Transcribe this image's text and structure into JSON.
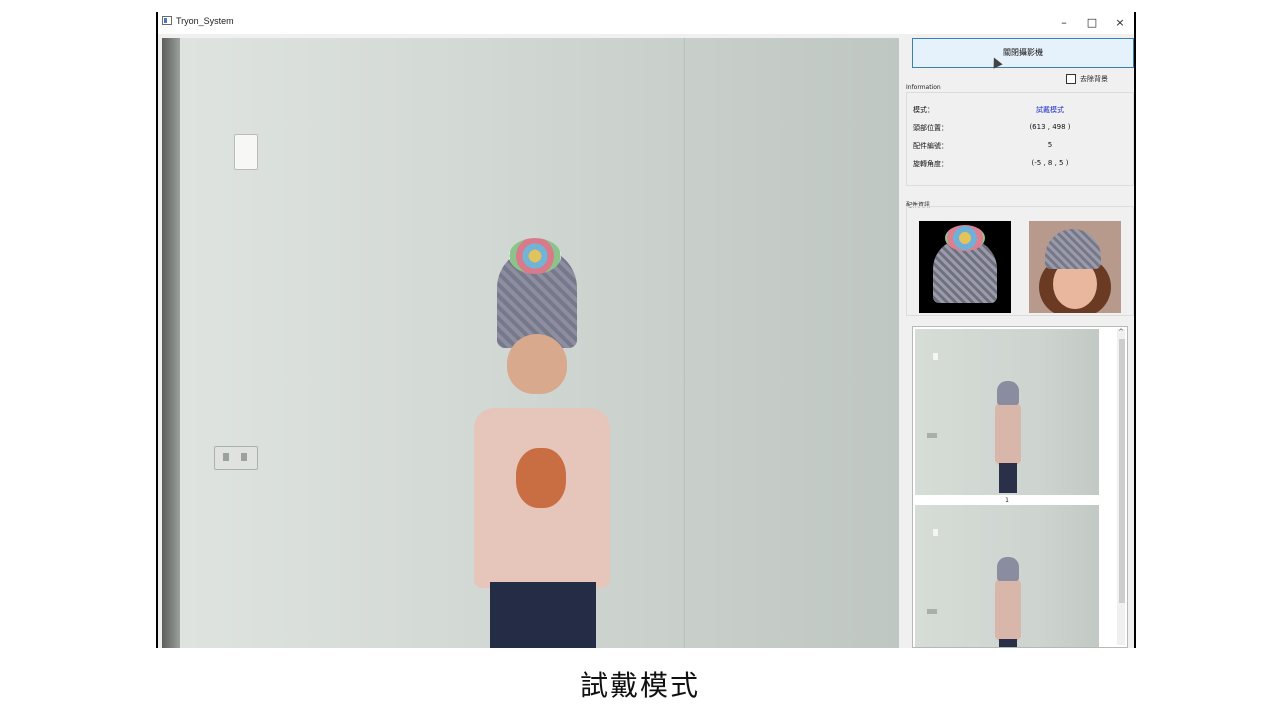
{
  "window": {
    "title": "Tryon_System",
    "minimize_glyph": "–",
    "maximize_glyph": "□",
    "close_glyph": "×"
  },
  "sidebar": {
    "close_camera_label": "關閉攝影機",
    "remove_bg_label": "去除背景",
    "remove_bg_checked": false,
    "info_group_label": "Information",
    "info": [
      {
        "label": "模式：",
        "value": "試戴模式"
      },
      {
        "label": "頭部位置：",
        "value": "(613 , 498 )"
      },
      {
        "label": "配件編號：",
        "value": "5"
      },
      {
        "label": "旋轉角度：",
        "value": "(-5 , 8 , 5 )"
      }
    ],
    "accessory_group_label": "配件資訊",
    "snapshots": [
      {
        "label": "1"
      },
      {
        "label": ""
      }
    ]
  },
  "caption": "試戴模式",
  "icons": {
    "app": "app-window-icon",
    "scroll_up": "chevron-up-icon"
  },
  "colors": {
    "mode_value": "#1a2ccc",
    "button_bg": "#e5f1fb",
    "button_border": "#3c7fb1"
  }
}
